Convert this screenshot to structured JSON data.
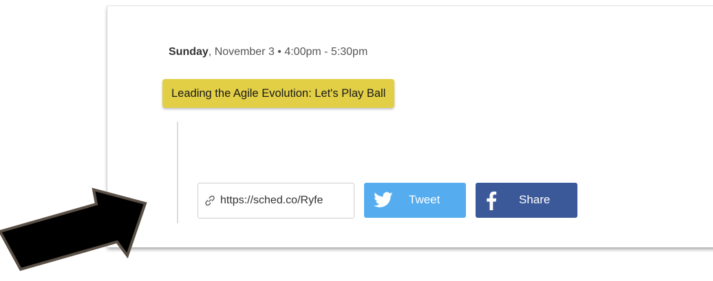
{
  "session": {
    "day": "Sunday",
    "date_rest": ", November 3 • 4:00pm - 5:30pm",
    "title": "Leading the Agile Evolution: Let's Play Ball"
  },
  "share": {
    "link_text": "https://sched.co/Ryfe",
    "tweet_label": "Tweet",
    "share_label": "Share"
  },
  "icons": {
    "link": "link-icon",
    "twitter": "twitter-bird-icon",
    "facebook": "facebook-f-icon",
    "annotation": "black-arrow-pointer"
  },
  "colors": {
    "event_pill": "#e2cf46",
    "twitter": "#55acee",
    "facebook": "#3b5998",
    "arrow": "#000000"
  }
}
